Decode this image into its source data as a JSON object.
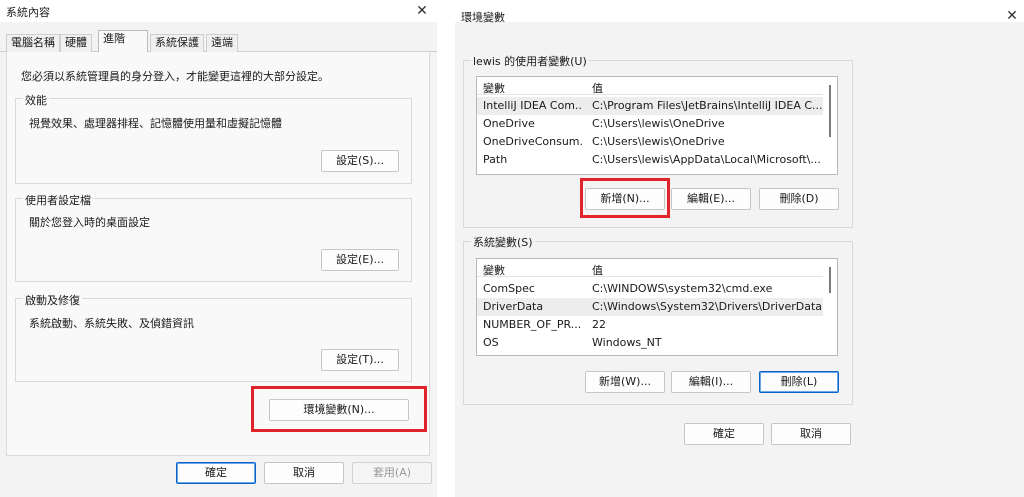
{
  "left": {
    "title": "系統內容",
    "tabs": [
      "電腦名稱",
      "硬體",
      "進階",
      "系統保護",
      "遠端"
    ],
    "admin_note": "您必須以系統管理員的身分登入，才能變更這裡的大部分設定。",
    "performance": {
      "title": "效能",
      "desc": "視覺效果、處理器排程、記憶體使用量和虛擬記憶體",
      "button": "設定(S)..."
    },
    "profiles": {
      "title": "使用者設定檔",
      "desc": "關於您登入時的桌面設定",
      "button": "設定(E)..."
    },
    "startup": {
      "title": "啟動及修復",
      "desc": "系統啟動、系統失敗、及偵錯資訊",
      "button": "設定(T)..."
    },
    "env_button": "環境變數(N)...",
    "footer": {
      "ok": "確定",
      "cancel": "取消",
      "apply": "套用(A)"
    }
  },
  "right": {
    "title": "環境變數",
    "user_group_title": "lewis 的使用者變數(U)",
    "system_group_title": "系統變數(S)",
    "col_var": "變數",
    "col_val": "值",
    "user_vars": [
      {
        "name": "IntelliJ IDEA Com...",
        "value": "C:\\Program Files\\JetBrains\\IntelliJ IDEA C..."
      },
      {
        "name": "OneDrive",
        "value": "C:\\Users\\lewis\\OneDrive"
      },
      {
        "name": "OneDriveConsum...",
        "value": "C:\\Users\\lewis\\OneDrive"
      },
      {
        "name": "Path",
        "value": "C:\\Users\\lewis\\AppData\\Local\\Microsoft\\..."
      }
    ],
    "system_vars": [
      {
        "name": "ComSpec",
        "value": "C:\\WINDOWS\\system32\\cmd.exe"
      },
      {
        "name": "DriverData",
        "value": "C:\\Windows\\System32\\Drivers\\DriverData"
      },
      {
        "name": "NUMBER_OF_PR...",
        "value": "22"
      },
      {
        "name": "OS",
        "value": "Windows_NT"
      }
    ],
    "user_buttons": {
      "new": "新增(N)...",
      "edit": "編輯(E)...",
      "delete": "刪除(D)"
    },
    "system_buttons": {
      "new": "新增(W)...",
      "edit": "編輯(I)...",
      "delete": "刪除(L)"
    },
    "footer": {
      "ok": "確定",
      "cancel": "取消"
    }
  },
  "icons": {
    "close": "close-icon"
  },
  "colors": {
    "highlight": "#e3232b",
    "focus": "#0a64c8"
  }
}
